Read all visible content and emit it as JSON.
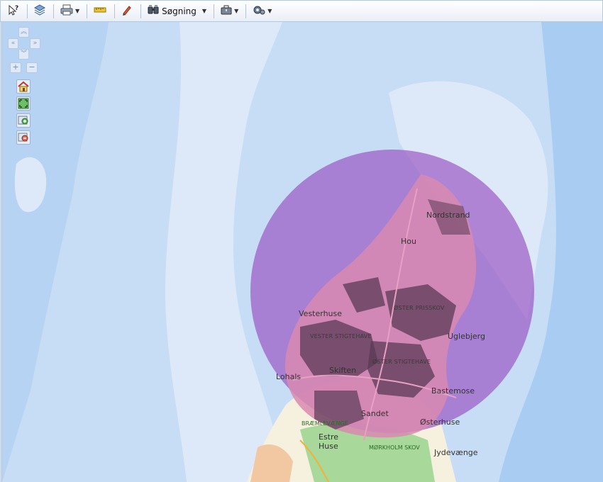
{
  "toolbar": {
    "help_icon": "help-pointer-icon",
    "layers_icon": "layers-icon",
    "print_icon": "printer-icon",
    "measure_icon": "ruler-icon",
    "draw_icon": "pen-icon",
    "search_icon": "search-binoculars-icon",
    "search_label": "Søgning",
    "tools_icon": "briefcase-icon",
    "settings_icon": "gear-icon"
  },
  "map_controls": {
    "pan_up": "≫",
    "pan_left": "«",
    "pan_right": "»",
    "pan_down": "≪",
    "zoom_in": "+",
    "zoom_out": "−",
    "home_icon": "home-icon",
    "full_extent_icon": "full-extent-icon",
    "zoom_box_in_icon": "zoom-box-in-icon",
    "zoom_box_out_icon": "zoom-box-out-icon"
  },
  "map": {
    "colors": {
      "sea": "#c7dcf5",
      "shallow": "#dde9f8",
      "deep": "#9ec5f0",
      "buffer": "#9b59c4",
      "land": "#f6f0df",
      "forest": "#a8d89a",
      "built": "#555"
    },
    "places": [
      {
        "name": "Nordstrand"
      },
      {
        "name": "Hou"
      },
      {
        "name": "Vesterhuse"
      },
      {
        "name": "ØSTER PRISSKOV"
      },
      {
        "name": "VESTER STIGTEHAVE"
      },
      {
        "name": "Uglebjerg"
      },
      {
        "name": "ØSTER STIGTEHAVE"
      },
      {
        "name": "Lohals"
      },
      {
        "name": "Skiften"
      },
      {
        "name": "Bastemose"
      },
      {
        "name": "Sandet"
      },
      {
        "name": "Østerhuse"
      },
      {
        "name": "BRÆMLEVÆNGE"
      },
      {
        "name": "Estre"
      },
      {
        "name": "Huse"
      },
      {
        "name": "MØRKHOLM SKOV"
      },
      {
        "name": "Jydevænge"
      }
    ]
  }
}
